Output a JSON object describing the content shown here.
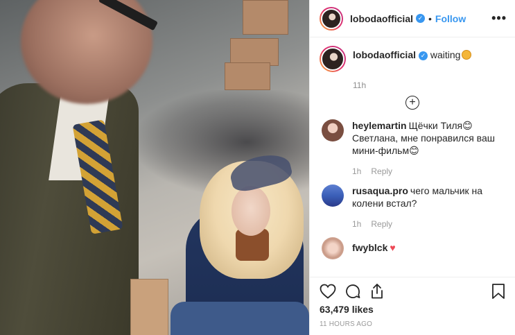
{
  "post": {
    "username": "lobodaofficial",
    "follow_label": "Follow",
    "separator": "•",
    "more_label": "•••",
    "caption": {
      "username": "lobodaofficial",
      "text": "waiting",
      "emoji": "hushed-face-emoji",
      "time": "11h"
    },
    "load_more_icon": "plus-circle-icon",
    "comments": [
      {
        "username": "heylemartin",
        "text": "Щёчки Тиля😊 Светлана, мне понравился ваш мини-фильм😊",
        "time": "1h",
        "reply": "Reply"
      },
      {
        "username": "rusaqua.pro",
        "text": "чего мальчик на колени встал?",
        "time": "1h",
        "reply": "Reply"
      },
      {
        "username": "fwyblck",
        "text": "♥",
        "time": "",
        "reply": ""
      }
    ],
    "actions": {
      "like_icon": "heart-icon",
      "comment_icon": "comment-icon",
      "share_icon": "share-icon",
      "save_icon": "bookmark-icon"
    },
    "likes": "63,479 likes",
    "timestamp": "11 HOURS AGO"
  },
  "colors": {
    "link_blue": "#3897f0",
    "heart_red": "#ed4956",
    "meta_gray": "#8e8e8e"
  }
}
